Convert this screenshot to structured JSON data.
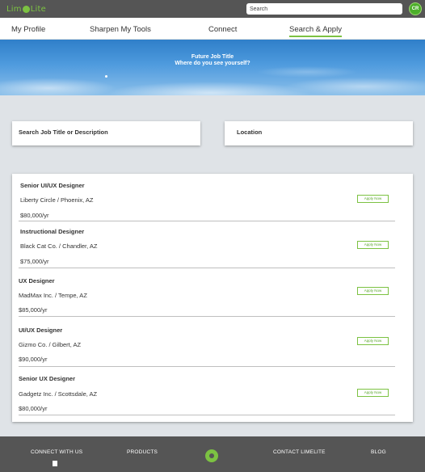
{
  "app": {
    "logo_text_left": "Lim",
    "logo_text_right": "Lite",
    "search_placeholder": "Search",
    "avatar_initials": "CR"
  },
  "nav": {
    "items": [
      {
        "label": "My Profile"
      },
      {
        "label": "Sharpen My Tools"
      },
      {
        "label": "Connect"
      },
      {
        "label": "Search & Apply",
        "active": true
      }
    ]
  },
  "hero": {
    "title": "Future Job Title",
    "subtitle": "Where do you see yourself?"
  },
  "search": {
    "job_label": "Search Job Title or Description",
    "location_label": "Location"
  },
  "jobs": [
    {
      "title": "Senior UI/UX Designer",
      "company": "Liberty Circle / Phoenix, AZ",
      "salary": "$80,000/yr",
      "apply": "Apply Now"
    },
    {
      "title": "Instructional Designer",
      "company": "Black Cat Co. / Chandler, AZ",
      "salary": "$75,000/yr",
      "apply": "Apply Now"
    },
    {
      "title": "UX Designer",
      "company": "MadMax Inc. / Tempe, AZ",
      "salary": "$85,000/yr",
      "apply": "Apply Now"
    },
    {
      "title": "UI/UX Designer",
      "company": "Gizmo Co. / Gilbert, AZ",
      "salary": "$90,000/yr",
      "apply": "Apply Now"
    },
    {
      "title": "Senior UX Designer",
      "company": "Gadgetz Inc. / Scottsdale, AZ",
      "salary": "$80,000/yr",
      "apply": "Apply Now"
    }
  ],
  "footer": {
    "connect": "CONNECT WITH US",
    "products": "PRODUCTS",
    "contact": "CONTACT LIMELITE",
    "blog": "BLOG"
  },
  "colors": {
    "brand_green": "#7cc242",
    "bar_gray": "#555555",
    "page_bg": "#dfe3e7"
  }
}
